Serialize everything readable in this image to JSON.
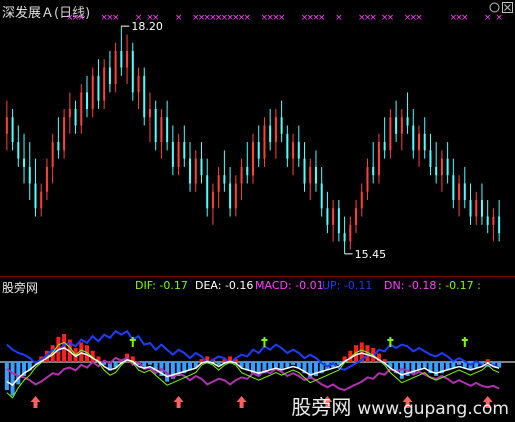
{
  "chart_header": {
    "title": "深发展Ａ",
    "period": "(日线)"
  },
  "annotations": {
    "high_label": "18.20",
    "low_label": "15.45"
  },
  "lower_panel": {
    "name": "股旁网",
    "indicators": [
      {
        "label": "DIF: -0.17",
        "color": "#7cfc00"
      },
      {
        "label": "DEA: -0.16",
        "color": "#ffffff"
      },
      {
        "label": "MACD: -0.01",
        "color": "#ff40ff"
      },
      {
        "label": "UP: -0.11",
        "color": "#1e3cff"
      },
      {
        "label": "DN: -0.18",
        "color": "#ff40ff"
      },
      {
        "label": ": -0.17 :",
        "color": "#7cfc00"
      }
    ]
  },
  "watermark": {
    "text": "股旁网",
    "domain": "www.gupang.com"
  },
  "icons": [
    "minimize-icon",
    "close-icon"
  ],
  "colors": {
    "background": "#000000",
    "up_candle": "#ff4040",
    "down_candle": "#54ffff",
    "macd_pos": "#ff2020",
    "macd_neg": "#3aa0ff",
    "signal_marker": "#ff40ff",
    "separator": "#8b0000"
  },
  "chart_data": {
    "type": "candlestick",
    "price_high": 18.2,
    "price_low": 15.45,
    "candles": [
      [
        16.9,
        17.3,
        16.7,
        17.1
      ],
      [
        17.1,
        17.2,
        16.7,
        16.8
      ],
      [
        16.8,
        17.0,
        16.5,
        16.6
      ],
      [
        16.6,
        16.9,
        16.3,
        16.5
      ],
      [
        16.5,
        16.8,
        16.1,
        16.3
      ],
      [
        16.3,
        16.6,
        15.9,
        16.0
      ],
      [
        16.0,
        16.3,
        15.9,
        16.2
      ],
      [
        16.2,
        16.6,
        16.1,
        16.5
      ],
      [
        16.5,
        16.9,
        16.3,
        16.8
      ],
      [
        16.8,
        17.1,
        16.6,
        16.7
      ],
      [
        16.7,
        17.2,
        16.6,
        17.1
      ],
      [
        17.1,
        17.4,
        16.9,
        17.2
      ],
      [
        17.2,
        17.3,
        16.9,
        17.0
      ],
      [
        17.0,
        17.5,
        16.9,
        17.4
      ],
      [
        17.4,
        17.6,
        17.1,
        17.2
      ],
      [
        17.2,
        17.7,
        17.1,
        17.6
      ],
      [
        17.6,
        17.8,
        17.2,
        17.3
      ],
      [
        17.3,
        17.8,
        17.2,
        17.7
      ],
      [
        17.7,
        17.9,
        17.4,
        17.5
      ],
      [
        17.5,
        18.0,
        17.4,
        17.9
      ],
      [
        17.9,
        18.2,
        17.6,
        17.7
      ],
      [
        17.7,
        18.1,
        17.5,
        17.9
      ],
      [
        17.9,
        18.0,
        17.3,
        17.4
      ],
      [
        17.4,
        17.7,
        17.2,
        17.6
      ],
      [
        17.6,
        17.7,
        17.0,
        17.1
      ],
      [
        17.1,
        17.4,
        16.8,
        17.2
      ],
      [
        17.2,
        17.3,
        16.7,
        16.8
      ],
      [
        16.8,
        17.2,
        16.6,
        17.1
      ],
      [
        17.1,
        17.3,
        16.7,
        16.8
      ],
      [
        16.8,
        17.0,
        16.4,
        16.5
      ],
      [
        16.5,
        16.9,
        16.4,
        16.8
      ],
      [
        16.8,
        17.0,
        16.5,
        16.6
      ],
      [
        16.6,
        16.8,
        16.2,
        16.3
      ],
      [
        16.3,
        16.7,
        16.2,
        16.6
      ],
      [
        16.6,
        16.8,
        16.3,
        16.4
      ],
      [
        16.4,
        16.6,
        15.9,
        16.0
      ],
      [
        16.0,
        16.3,
        15.8,
        16.2
      ],
      [
        16.2,
        16.5,
        16.0,
        16.4
      ],
      [
        16.4,
        16.7,
        16.2,
        16.3
      ],
      [
        16.3,
        16.5,
        15.9,
        16.0
      ],
      [
        16.0,
        16.4,
        15.9,
        16.3
      ],
      [
        16.3,
        16.6,
        16.1,
        16.5
      ],
      [
        16.5,
        16.8,
        16.3,
        16.4
      ],
      [
        16.4,
        16.9,
        16.3,
        16.8
      ],
      [
        16.8,
        17.0,
        16.5,
        16.6
      ],
      [
        16.6,
        17.1,
        16.5,
        17.0
      ],
      [
        17.0,
        17.2,
        16.7,
        16.8
      ],
      [
        16.8,
        17.2,
        16.6,
        17.1
      ],
      [
        17.1,
        17.3,
        16.8,
        16.9
      ],
      [
        16.9,
        17.0,
        16.5,
        16.6
      ],
      [
        16.6,
        16.9,
        16.4,
        16.8
      ],
      [
        16.8,
        17.0,
        16.5,
        16.6
      ],
      [
        16.6,
        16.8,
        16.2,
        16.3
      ],
      [
        16.3,
        16.6,
        16.1,
        16.5
      ],
      [
        16.5,
        16.7,
        16.2,
        16.3
      ],
      [
        16.3,
        16.5,
        15.9,
        16.0
      ],
      [
        16.0,
        16.2,
        15.7,
        15.8
      ],
      [
        15.8,
        16.1,
        15.6,
        16.0
      ],
      [
        16.0,
        16.1,
        15.6,
        15.7
      ],
      [
        15.7,
        15.9,
        15.45,
        15.6
      ],
      [
        15.6,
        15.9,
        15.5,
        15.8
      ],
      [
        15.8,
        16.1,
        15.7,
        16.0
      ],
      [
        16.0,
        16.3,
        15.9,
        16.2
      ],
      [
        16.2,
        16.6,
        16.1,
        16.5
      ],
      [
        16.5,
        16.8,
        16.3,
        16.4
      ],
      [
        16.4,
        16.9,
        16.3,
        16.8
      ],
      [
        16.8,
        17.1,
        16.6,
        16.7
      ],
      [
        16.7,
        17.2,
        16.6,
        17.1
      ],
      [
        17.1,
        17.3,
        16.8,
        16.9
      ],
      [
        16.9,
        17.2,
        16.7,
        17.1
      ],
      [
        17.1,
        17.4,
        16.9,
        17.0
      ],
      [
        17.0,
        17.2,
        16.6,
        16.7
      ],
      [
        16.7,
        17.0,
        16.5,
        16.9
      ],
      [
        16.9,
        17.1,
        16.6,
        16.7
      ],
      [
        16.7,
        16.9,
        16.4,
        16.5
      ],
      [
        16.5,
        16.8,
        16.3,
        16.4
      ],
      [
        16.4,
        16.7,
        16.2,
        16.6
      ],
      [
        16.6,
        16.8,
        16.3,
        16.4
      ],
      [
        16.4,
        16.6,
        16.0,
        16.1
      ],
      [
        16.1,
        16.4,
        15.9,
        16.3
      ],
      [
        16.3,
        16.5,
        16.0,
        16.1
      ],
      [
        16.1,
        16.3,
        15.8,
        15.9
      ],
      [
        15.9,
        16.2,
        15.8,
        16.1
      ],
      [
        16.1,
        16.3,
        15.8,
        15.9
      ],
      [
        15.9,
        16.1,
        15.7,
        15.8
      ],
      [
        15.8,
        16.0,
        15.6,
        15.9
      ],
      [
        15.9,
        16.1,
        15.6,
        15.7
      ]
    ],
    "macd_hist": [
      -0.1,
      -0.12,
      -0.08,
      -0.05,
      -0.03,
      0.0,
      0.02,
      0.04,
      0.06,
      0.09,
      0.1,
      0.08,
      0.05,
      0.07,
      0.06,
      0.04,
      0.02,
      -0.01,
      -0.03,
      -0.02,
      0.01,
      0.03,
      0.02,
      -0.01,
      -0.02,
      -0.01,
      -0.03,
      -0.05,
      -0.07,
      -0.06,
      -0.05,
      -0.04,
      -0.03,
      -0.02,
      0.01,
      0.02,
      0.01,
      -0.01,
      0.01,
      0.02,
      0.01,
      -0.02,
      -0.03,
      -0.04,
      -0.05,
      -0.04,
      -0.03,
      -0.02,
      -0.03,
      -0.02,
      -0.01,
      -0.02,
      -0.04,
      -0.06,
      -0.05,
      -0.04,
      -0.03,
      -0.02,
      -0.01,
      0.02,
      0.04,
      0.06,
      0.07,
      0.06,
      0.05,
      0.03,
      0.01,
      -0.02,
      -0.04,
      -0.06,
      -0.05,
      -0.04,
      -0.03,
      -0.02,
      -0.04,
      -0.05,
      -0.04,
      -0.03,
      -0.02,
      -0.01,
      -0.02,
      -0.03,
      -0.02,
      -0.01,
      0.01,
      -0.01,
      -0.02
    ]
  }
}
